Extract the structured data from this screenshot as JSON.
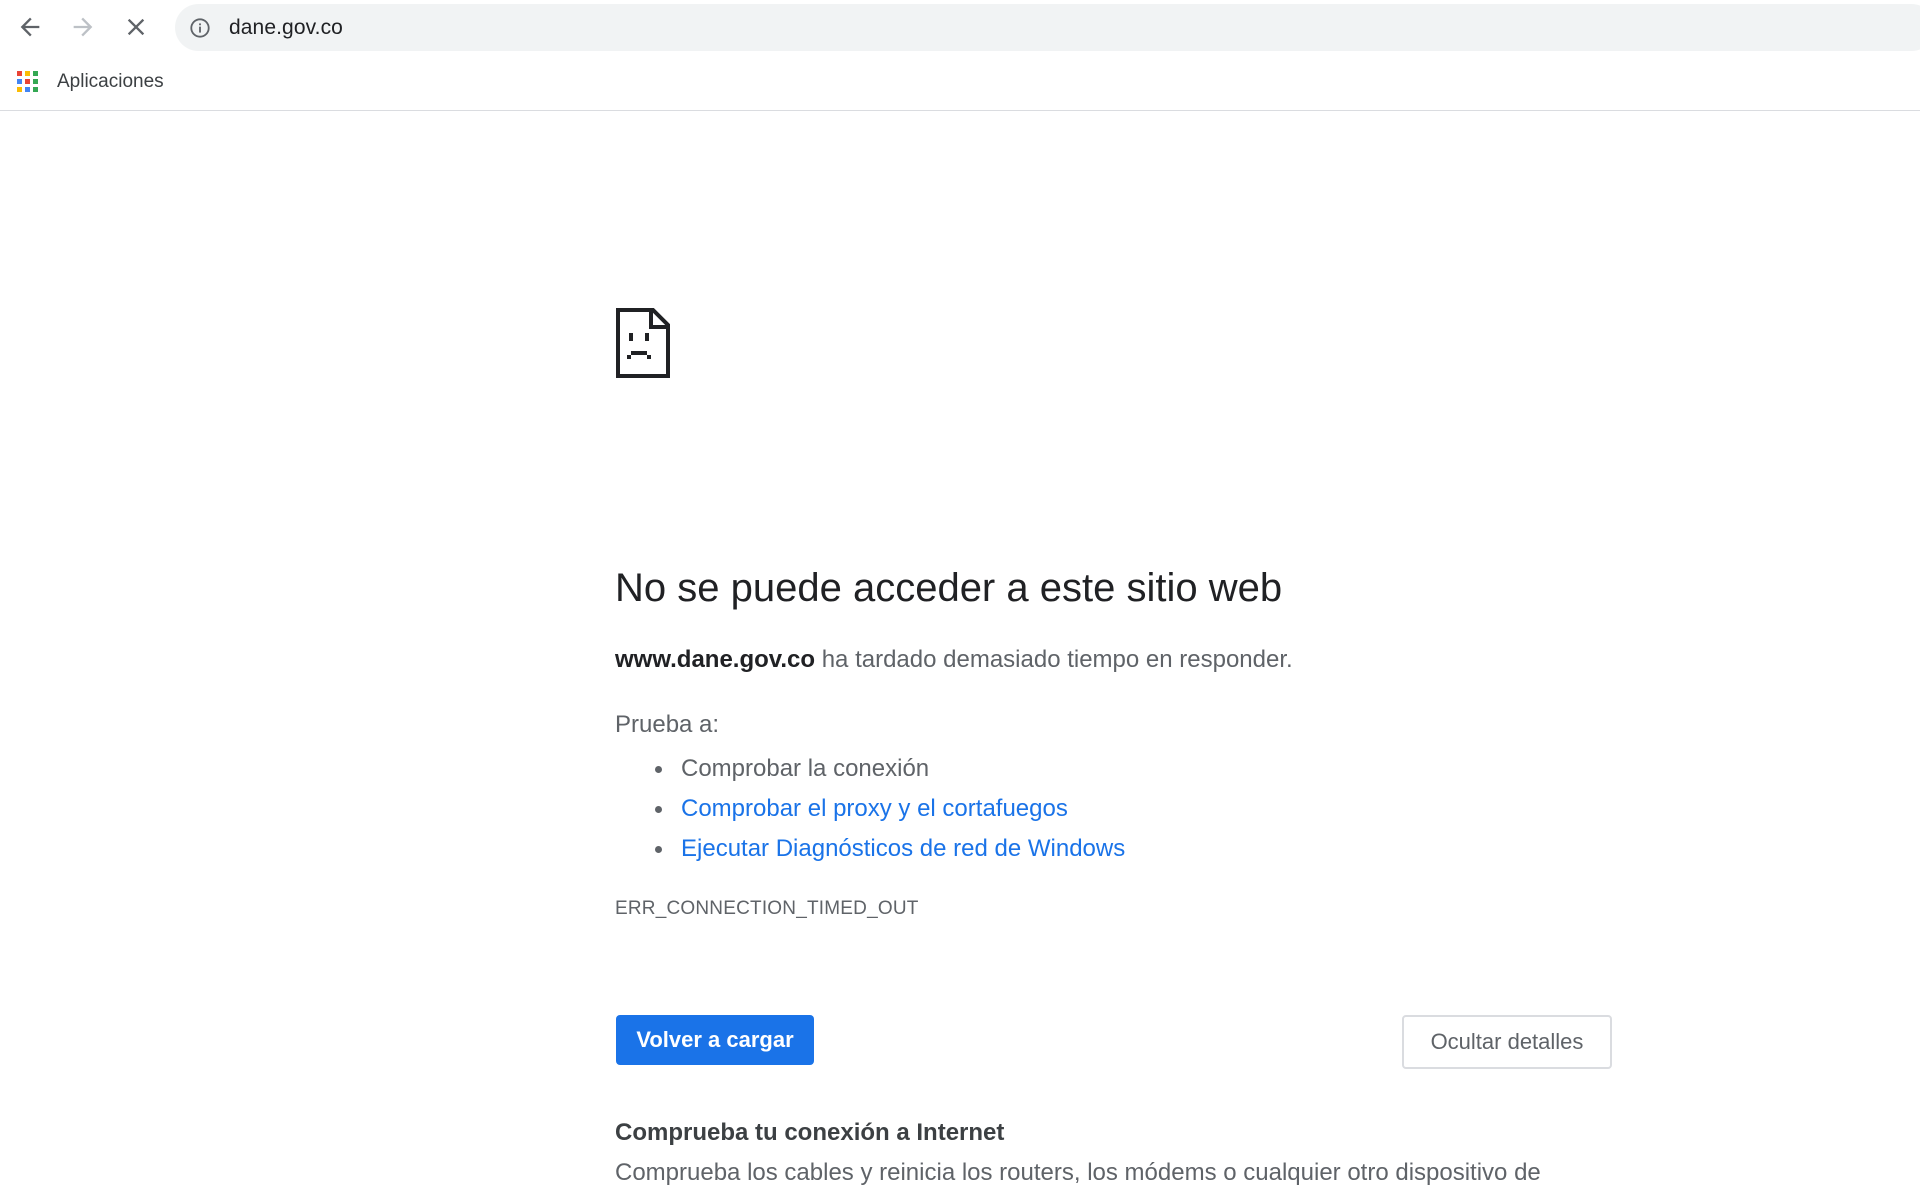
{
  "toolbar": {
    "back_icon": "arrow-left-icon",
    "forward_icon": "arrow-right-icon",
    "stop_icon": "close-icon",
    "info_icon": "info-icon",
    "url": "dane.gov.co"
  },
  "bookmarks": {
    "apps_icon": "apps-grid-icon",
    "apps_label": "Aplicaciones",
    "apps_colors": [
      "#ea4335",
      "#fbbc04",
      "#34a853",
      "#4285f4",
      "#ea4335",
      "#34a853",
      "#fbbc04",
      "#4285f4",
      "#34a853"
    ]
  },
  "error": {
    "icon": "sad-page-icon",
    "headline": "No se puede acceder a este sitio web",
    "host": "www.dane.gov.co",
    "summary_rest": " ha tardado demasiado tiempo en responder.",
    "try_label": "Prueba a:",
    "suggestions": [
      {
        "text": "Comprobar la conexión",
        "is_link": false
      },
      {
        "text": "Comprobar el proxy y el cortafuegos",
        "is_link": true
      },
      {
        "text": "Ejecutar Diagnósticos de red de Windows",
        "is_link": true
      }
    ],
    "code": "ERR_CONNECTION_TIMED_OUT",
    "reload_label": "Volver a cargar",
    "details_label": "Ocultar detalles",
    "details_heading": "Comprueba tu conexión a Internet",
    "details_body": "Comprueba los cables y reinicia los routers, los módems o cualquier otro dispositivo de"
  },
  "colors": {
    "accent": "#1a73e8",
    "link": "#1a73e8",
    "text_primary": "#202124",
    "text_secondary": "#5f6368",
    "omnibox_bg": "#f1f3f4"
  }
}
